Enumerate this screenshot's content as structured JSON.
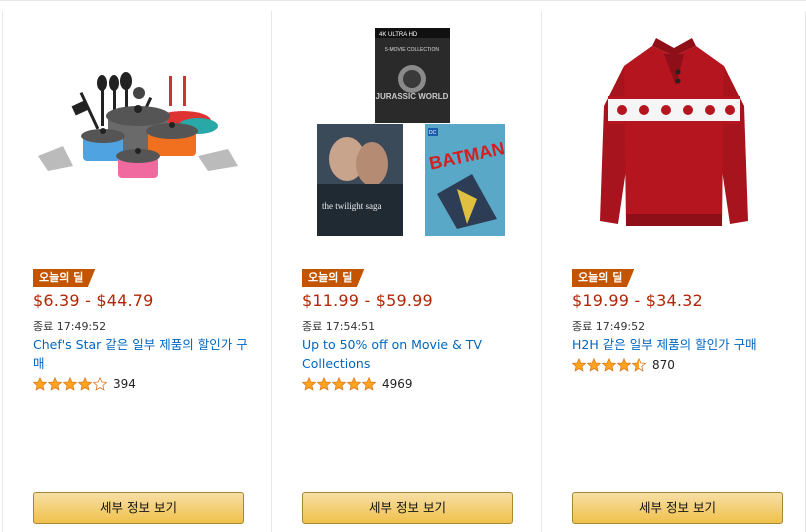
{
  "deals": [
    {
      "badge": "오늘의 딜",
      "price": "$6.39 - $44.79",
      "ends": "종료 17:49:52",
      "title": "Chef's Star 같은 일부 제품의 할인가 구매",
      "stars": 4,
      "rating_count": "394",
      "button": "세부 정보 보기",
      "image": "cookware-set-image"
    },
    {
      "badge": "오늘의 딜",
      "price": "$11.99 - $59.99",
      "ends": "종료 17:54:51",
      "title": "Up to 50% off on Movie & TV Collections",
      "stars": 5,
      "rating_count": "4969",
      "button": "세부 정보 보기",
      "image": "movie-collections-image",
      "image_text": {
        "top_badge": "4K ULTRA HD",
        "top_series": "5-MOVIE COLLECTION",
        "top_title": "JURASSIC WORLD",
        "left_title": "the twilight saga",
        "right_brand": "DC",
        "right_title": "BATMAN"
      }
    },
    {
      "badge": "오늘의 딜",
      "price": "$19.99 - $34.32",
      "ends": "종료 17:49:52",
      "title": "H2H 같은 일부 제품의 할인가 구매",
      "stars": 4.5,
      "rating_count": "870",
      "button": "세부 정보 보기",
      "image": "red-sweater-image"
    }
  ],
  "colors": {
    "badge": "#c45500",
    "price": "#b12704",
    "link": "#0066c0",
    "star": "#ffa41c",
    "button": "#f0c14b"
  }
}
